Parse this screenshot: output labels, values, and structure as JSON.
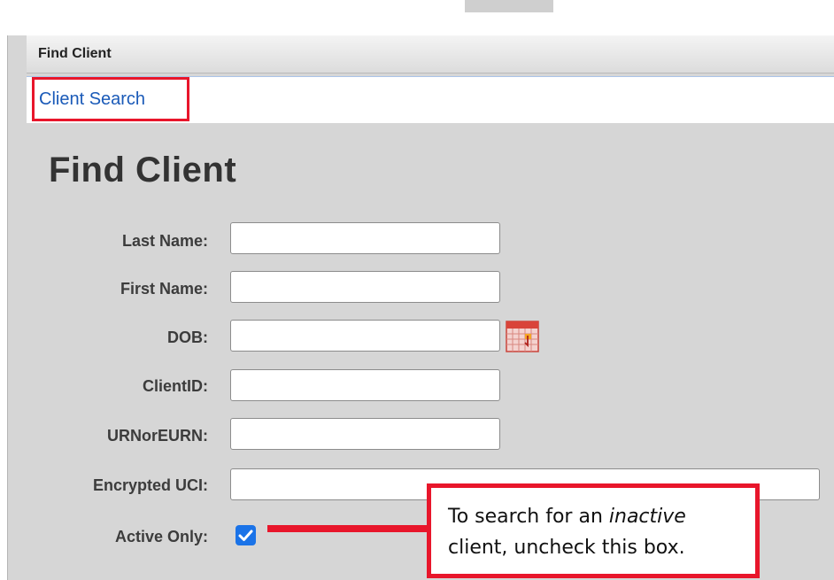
{
  "panel": {
    "title": "Find Client"
  },
  "breadcrumb": {
    "link": "Client Search"
  },
  "page": {
    "heading": "Find Client"
  },
  "form": {
    "last_name": {
      "label": "Last Name:",
      "value": ""
    },
    "first_name": {
      "label": "First Name:",
      "value": ""
    },
    "dob": {
      "label": "DOB:",
      "value": ""
    },
    "client_id": {
      "label": "ClientID:",
      "value": ""
    },
    "urn": {
      "label": "URNorEURN:",
      "value": ""
    },
    "uci": {
      "label": "Encrypted UCI:",
      "value": ""
    },
    "active_only": {
      "label": "Active Only:",
      "checked": true
    }
  },
  "callout": {
    "text_before": "To search for an ",
    "emphasis": "inactive",
    "text_after": "client, uncheck this box."
  },
  "icons": {
    "calendar": "calendar-icon",
    "checkmark": "checkmark-icon"
  },
  "colors": {
    "highlight": "#e8162b",
    "link": "#1a5ab8",
    "checkbox": "#1a73e8"
  }
}
